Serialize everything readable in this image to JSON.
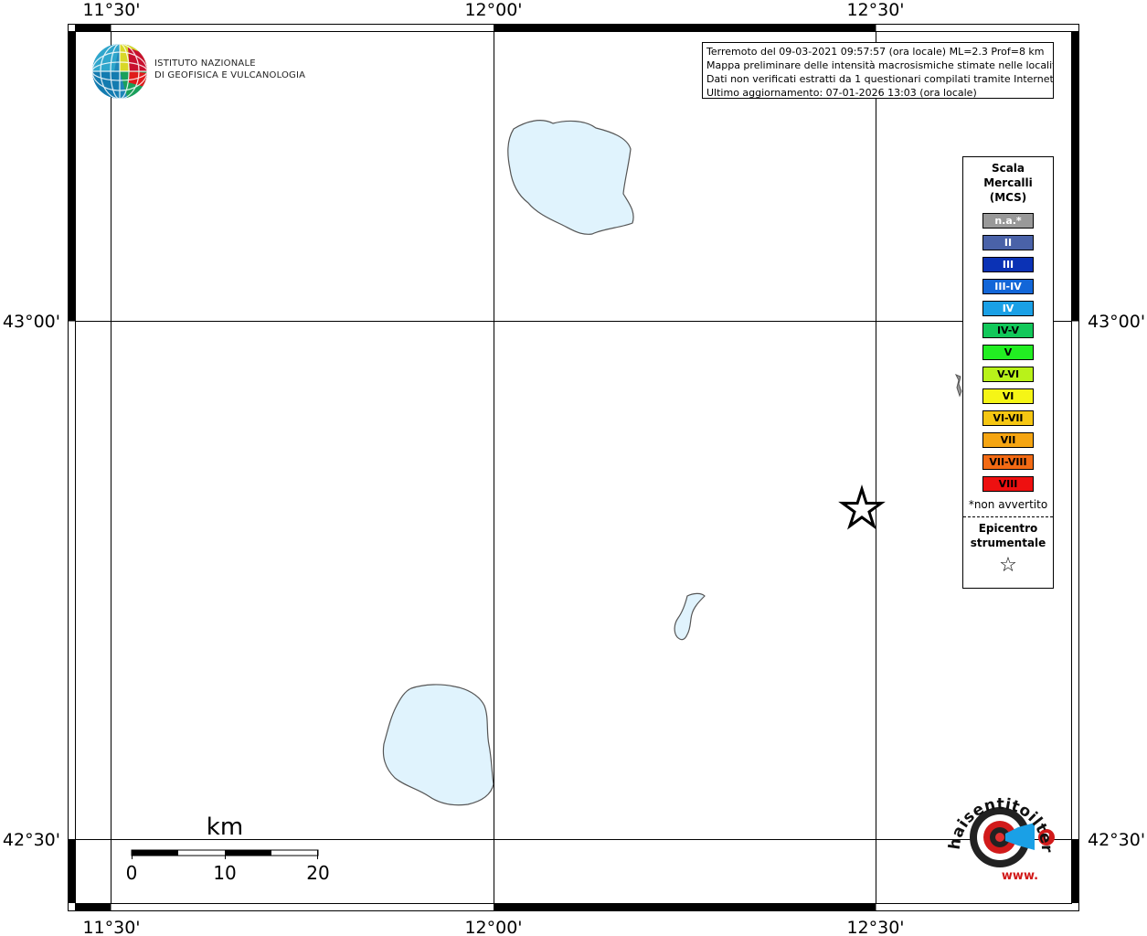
{
  "map": {
    "lon_labels": [
      "11°30'",
      "12°00'",
      "12°30'"
    ],
    "lat_labels": [
      "43°00'",
      "42°30'"
    ],
    "land_color": "#ffffff",
    "water_color": "#e0f3fd",
    "water_outline_color": "#555555"
  },
  "logo": {
    "line1": "ISTITUTO NAZIONALE",
    "line2": "DI GEOFISICA E VULCANOLOGIA"
  },
  "info": {
    "line1": "Terremoto del 09-03-2021 09:57:57 (ora locale) ML=2.3 Prof=8 km",
    "line2": "Mappa preliminare delle intensità macrosismiche stimate nelle località",
    "line3": "Dati non verificati estratti da 1 questionari compilati tramite Internet.",
    "line4": "Ultimo aggiornamento: 07-01-2026 13:03 (ora locale)"
  },
  "legend": {
    "title_line1": "Scala",
    "title_line2": "Mercalli",
    "title_line3": "(MCS)",
    "items": [
      {
        "label": "n.a.*",
        "color": "#999999",
        "text_color": "#ffffff"
      },
      {
        "label": "II",
        "color": "#4a62a8",
        "text_color": "#ffffff"
      },
      {
        "label": "III",
        "color": "#0b32b5",
        "text_color": "#ffffff"
      },
      {
        "label": "III-IV",
        "color": "#1266d8",
        "text_color": "#ffffff"
      },
      {
        "label": "IV",
        "color": "#1aa0e6",
        "text_color": "#ffffff"
      },
      {
        "label": "IV-V",
        "color": "#12c85a",
        "text_color": "#000000"
      },
      {
        "label": "V",
        "color": "#22ee22",
        "text_color": "#000000"
      },
      {
        "label": "V-VI",
        "color": "#b8f21a",
        "text_color": "#000000"
      },
      {
        "label": "VI",
        "color": "#f5f516",
        "text_color": "#000000"
      },
      {
        "label": "VI-VII",
        "color": "#f5c612",
        "text_color": "#000000"
      },
      {
        "label": "VII",
        "color": "#f5a512",
        "text_color": "#000000"
      },
      {
        "label": "VII-VIII",
        "color": "#f26a14",
        "text_color": "#000000"
      },
      {
        "label": "VIII",
        "color": "#ee1010",
        "text_color": "#000000"
      }
    ],
    "note": "*non avvertito",
    "epicenter_line1": "Epicentro",
    "epicenter_line2": "strumentale",
    "epicenter_symbol": "☆"
  },
  "scale_bar": {
    "unit": "km",
    "labels": [
      "0",
      "10",
      "20"
    ]
  },
  "hsit_logo": {
    "text": "haisentitoilterremoto.it",
    "prefix": "www.",
    "question": "?"
  }
}
